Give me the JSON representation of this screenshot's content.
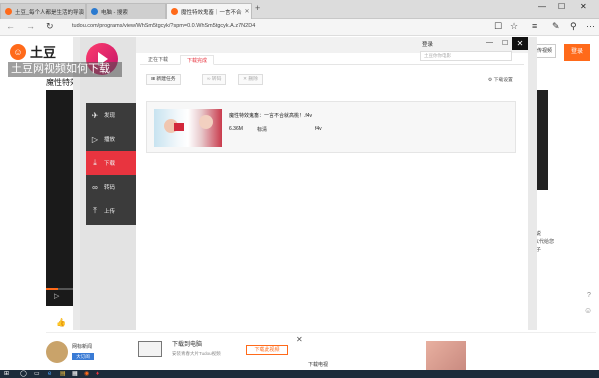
{
  "browser": {
    "tabs": [
      {
        "label": "土豆_每个人都是生活的导演"
      },
      {
        "label": "电脑 - 搜索"
      },
      {
        "label": "魔性特效鬼畜｜一言不合"
      }
    ],
    "new_tab": "+",
    "url": "tudou.com/programs/view/WhSm5tgcyk/?spm=0.0.WhSm5tgcyk.A.z7N2D4",
    "back": "←",
    "forward": "→",
    "refresh": "↻",
    "window_controls": {
      "minimize": "—",
      "maximize": "☐",
      "close": "✕"
    },
    "toolbar_icons": {
      "reading": "☐",
      "favorite": "☆",
      "hub": "≡",
      "notes": "✎",
      "share": "⚲",
      "more": "···"
    }
  },
  "site": {
    "logo_glyph": "☺",
    "logo_text": "土豆",
    "watermark": "土豆网视频如何下载",
    "title": "魔性特效",
    "upload_label": "上传视频",
    "login_label": "登录",
    "like_icon": "👍",
    "side_text_1": "说",
    "side_text_2": "以代给您",
    "side_text_3": "子",
    "play_icon": "▷",
    "bottom_ad": {
      "channel_name": "网标新闻",
      "channel_badge": "大订阅",
      "title": "下载到电脑",
      "subtitle": "安装青春大片Tudou视频",
      "button": "下载此视频",
      "close": "✕",
      "title2": "下载电视"
    }
  },
  "dialog": {
    "login": "登录",
    "search_placeholder": "土豆你你电影",
    "close": "✕",
    "tabs": [
      {
        "label": "正在下载"
      },
      {
        "label": "下载完成"
      }
    ],
    "toolbar": {
      "new_task": "新建任务",
      "convert": "转码",
      "delete": "删除",
      "settings": "下载设置"
    },
    "sidebar": [
      {
        "label": "发现",
        "icon": "✈"
      },
      {
        "label": "播放",
        "icon": "▷"
      },
      {
        "label": "下载",
        "icon": "⤓"
      },
      {
        "label": "转码",
        "icon": "∞"
      },
      {
        "label": "上传",
        "icon": "⤒"
      }
    ],
    "item": {
      "name": "魔性特效鬼畜：一言不合就高桃！.f4v",
      "size": "6.36M",
      "quality": "标清",
      "format": "f4v"
    }
  },
  "taskbar": {
    "start": "⊞",
    "search": "◯",
    "task_view": "▭",
    "edge": "e",
    "folder": "▤",
    "store": "▦",
    "app": "◉",
    "app2": "♦"
  }
}
